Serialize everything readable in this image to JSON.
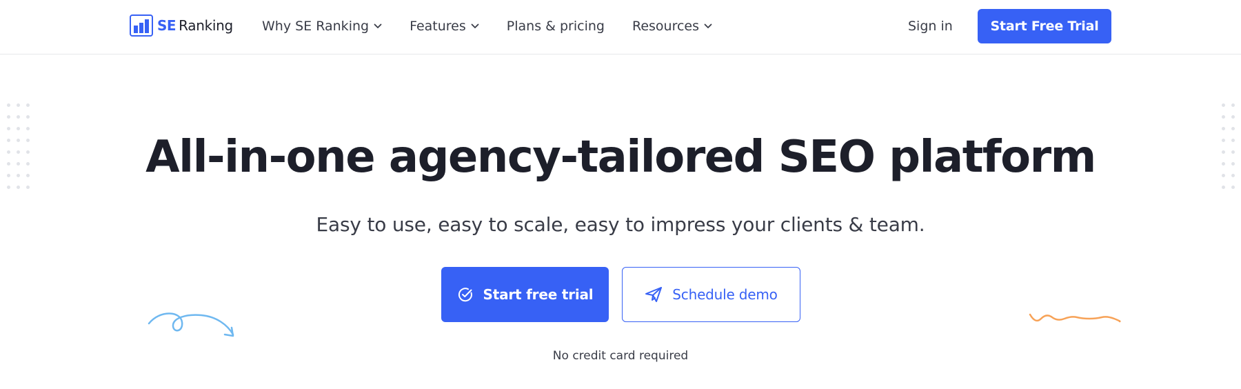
{
  "brand": {
    "logo_icon": "bar-chart-logo-icon",
    "name_part1": "SE",
    "name_part2": "Ranking",
    "accent_color": "#3761f5"
  },
  "nav": {
    "items": [
      {
        "label": "Why SE Ranking",
        "has_dropdown": true
      },
      {
        "label": "Features",
        "has_dropdown": true
      },
      {
        "label": "Plans & pricing",
        "has_dropdown": false
      },
      {
        "label": "Resources",
        "has_dropdown": true
      }
    ],
    "dropdown_icon": "chevron-down-icon"
  },
  "header": {
    "sign_in_label": "Sign in",
    "cta_label": "Start Free Trial"
  },
  "hero": {
    "title": "All-in-one agency-tailored SEO platform",
    "subtitle": "Easy to use, easy to scale, easy to impress your clients & team.",
    "primary_button": {
      "label": "Start free trial",
      "icon": "check-circle-icon"
    },
    "secondary_button": {
      "label": "Schedule demo",
      "icon": "paper-plane-icon"
    },
    "note": "No credit card required"
  },
  "decor": {
    "left_squiggle_color": "#6fb8f0",
    "right_squiggle_color": "#f7a257",
    "dot_color": "#e1e3e8"
  }
}
